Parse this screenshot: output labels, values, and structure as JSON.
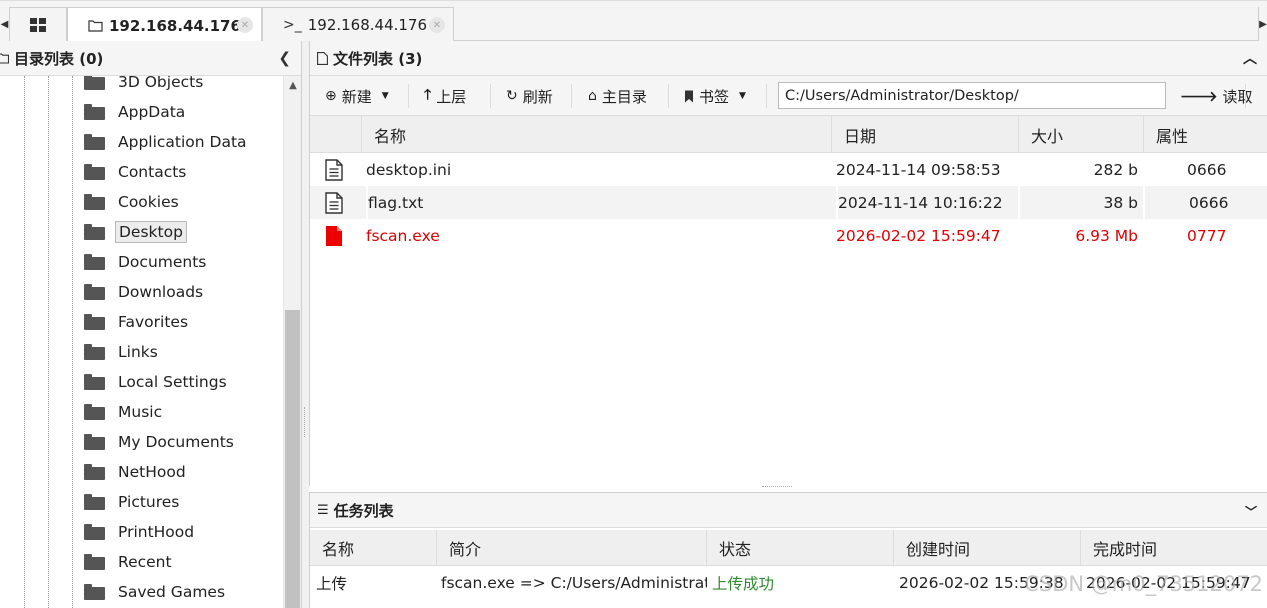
{
  "tabs": [
    {
      "label": "192.168.44.176",
      "icon": "folder-icon",
      "active": true
    },
    {
      "label": "192.168.44.176",
      "icon": "terminal-icon",
      "active": false
    }
  ],
  "left_panel": {
    "title": "目录列表 (0)",
    "items": [
      {
        "label": "3D Objects"
      },
      {
        "label": "AppData"
      },
      {
        "label": "Application Data"
      },
      {
        "label": "Contacts"
      },
      {
        "label": "Cookies"
      },
      {
        "label": "Desktop",
        "selected": true
      },
      {
        "label": "Documents"
      },
      {
        "label": "Downloads"
      },
      {
        "label": "Favorites"
      },
      {
        "label": "Links"
      },
      {
        "label": "Local Settings"
      },
      {
        "label": "Music"
      },
      {
        "label": "My Documents"
      },
      {
        "label": "NetHood"
      },
      {
        "label": "Pictures"
      },
      {
        "label": "PrintHood"
      },
      {
        "label": "Recent"
      },
      {
        "label": "Saved Games"
      }
    ]
  },
  "file_panel": {
    "title": "文件列表 (3)",
    "toolbar": {
      "new_label": "新建",
      "up_label": "上层",
      "refresh_label": "刷新",
      "home_label": "主目录",
      "bookmark_label": "书签",
      "path_value": "C:/Users/Administrator/Desktop/",
      "read_label": "读取"
    },
    "columns": {
      "name": "名称",
      "date": "日期",
      "size": "大小",
      "attr": "属性"
    },
    "files": [
      {
        "name": "desktop.ini",
        "date": "2024-11-14 09:58:53",
        "size": "282 b",
        "attr": "0666",
        "color": "#222222"
      },
      {
        "name": "flag.txt",
        "date": "2024-11-14 10:16:22",
        "size": "38 b",
        "attr": "0666",
        "color": "#222222"
      },
      {
        "name": "fscan.exe",
        "date": "2026-02-02 15:59:47",
        "size": "6.93 Mb",
        "attr": "0777",
        "color": "#e00000"
      }
    ]
  },
  "task_panel": {
    "title": "任务列表",
    "columns": {
      "name": "名称",
      "desc": "简介",
      "status": "状态",
      "created": "创建时间",
      "finished": "完成时间"
    },
    "rows": [
      {
        "name": "上传",
        "desc": "fscan.exe => C:/Users/Administrator",
        "status": "上传成功",
        "created": "2026-02-02 15:59:38",
        "finished": "2026-02-02 15:59:47",
        "status_color": "#2e8b2e"
      }
    ]
  },
  "watermark": "CSDN @m0_73512072"
}
